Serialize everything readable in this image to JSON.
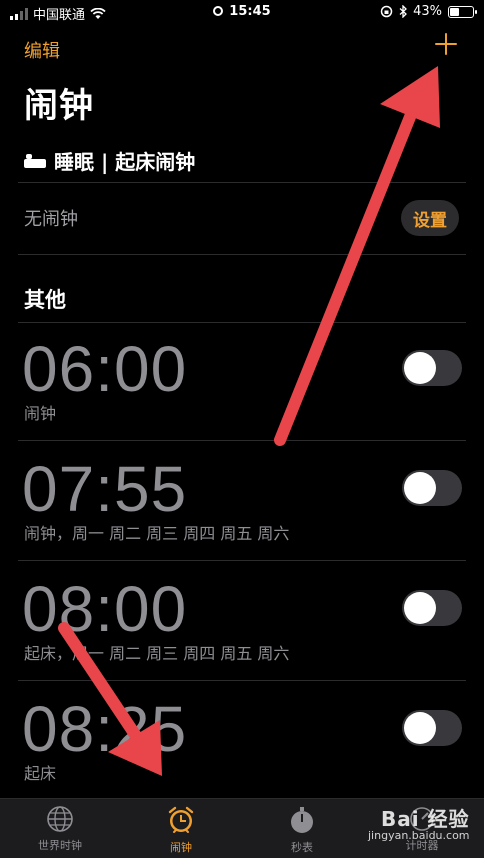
{
  "status_bar": {
    "carrier": "中国联通",
    "time": "15:45",
    "battery": "43%",
    "battery_level": 0.43
  },
  "header": {
    "edit_label": "编辑",
    "title": "闹钟"
  },
  "sleep": {
    "header": "睡眠 | 起床闹钟",
    "no_alarm": "无闹钟",
    "setup_label": "设置"
  },
  "others": {
    "header": "其他",
    "alarms": [
      {
        "time": "06:00",
        "label": "闹钟",
        "enabled": false
      },
      {
        "time": "07:55",
        "label": "闹钟，周一 周二 周三 周四 周五 周六",
        "enabled": false
      },
      {
        "time": "08:00",
        "label": "起床，周一 周二 周三 周四 周五 周六",
        "enabled": false
      },
      {
        "time": "08:25",
        "label": "起床",
        "enabled": false
      }
    ]
  },
  "tab_bar": {
    "tabs": [
      {
        "label": "世界时钟",
        "icon": "globe-icon",
        "active": false
      },
      {
        "label": "闹钟",
        "icon": "alarm-clock-icon",
        "active": true
      },
      {
        "label": "秒表",
        "icon": "stopwatch-icon",
        "active": false
      },
      {
        "label": "计时器",
        "icon": "timer-icon",
        "active": false
      }
    ]
  },
  "colors": {
    "accent": "#f0a030",
    "annotation_arrow": "#e8464a",
    "background": "#000000"
  },
  "watermark": {
    "brand": "Bai 经验",
    "url": "jingyan.baidu.com"
  }
}
